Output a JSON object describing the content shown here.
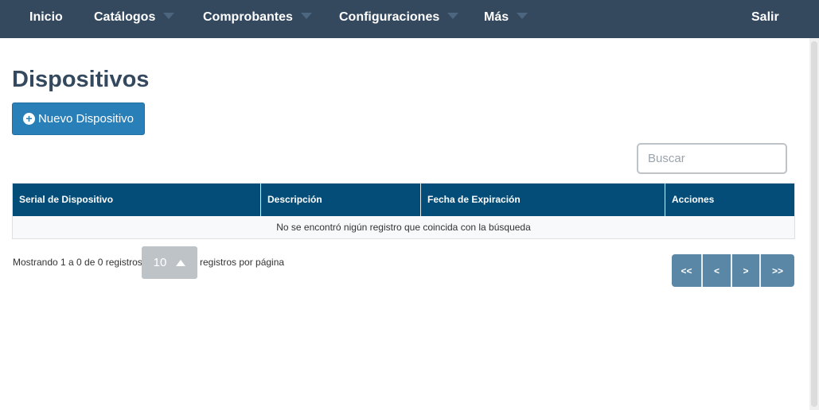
{
  "nav": {
    "inicio": "Inicio",
    "catalogos": "Catálogos",
    "comprobantes": "Comprobantes",
    "configuraciones": "Configuraciones",
    "mas": "Más",
    "salir": "Salir"
  },
  "page": {
    "title": "Dispositivos",
    "new_button": "Nuevo Dispositivo"
  },
  "search": {
    "placeholder": "Buscar"
  },
  "table": {
    "columns": [
      "Serial de Dispositivo",
      "Descripción",
      "Fecha de Expiración",
      "Acciones"
    ],
    "empty_message": "No se encontró nigún registro que coincida con la búsqueda"
  },
  "pagination": {
    "info": "Mostrando 1 a 0 de 0 registros",
    "page_size": "10",
    "per_page": "registros por página",
    "buttons": [
      "<<",
      "<",
      ">",
      ">>"
    ]
  },
  "colors": {
    "navbar": "#34495e",
    "primary_button": "#2980b9",
    "table_header": "#034d78",
    "pager": "#5b87a7"
  },
  "icons": {
    "new_button": "plus-circle-icon",
    "dropdown": "caret-down-icon",
    "page_size": "caret-up-icon"
  }
}
